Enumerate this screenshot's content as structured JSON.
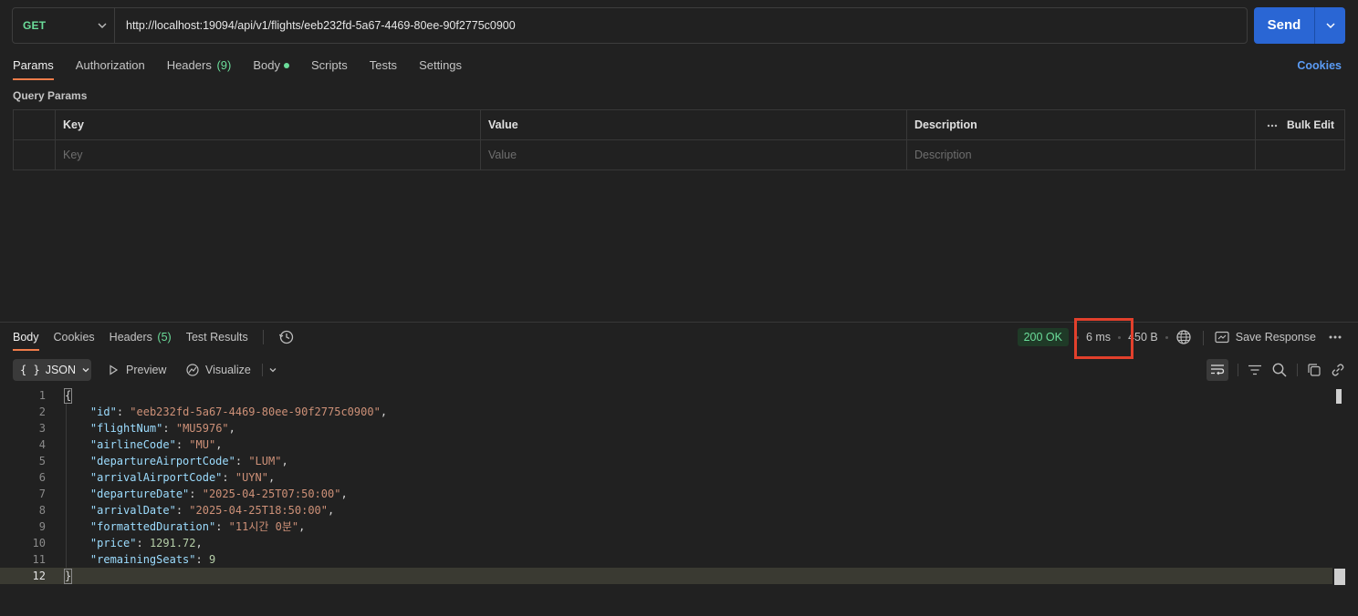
{
  "request": {
    "method": "GET",
    "url": "http://localhost:19094/api/v1/flights/eeb232fd-5a67-4469-80ee-90f2775c0900",
    "send_label": "Send"
  },
  "req_tabs": {
    "params": "Params",
    "authorization": "Authorization",
    "headers": "Headers",
    "headers_count": "(9)",
    "body": "Body",
    "scripts": "Scripts",
    "tests": "Tests",
    "settings": "Settings",
    "cookies": "Cookies"
  },
  "query_params": {
    "title": "Query Params",
    "columns": {
      "key": "Key",
      "value": "Value",
      "description": "Description"
    },
    "bulk_edit": "Bulk Edit",
    "placeholders": {
      "key": "Key",
      "value": "Value",
      "description": "Description"
    }
  },
  "response": {
    "tabs": {
      "body": "Body",
      "cookies": "Cookies",
      "headers": "Headers",
      "headers_count": "(5)",
      "test_results": "Test Results"
    },
    "status": "200 OK",
    "time": "6 ms",
    "size": "450 B",
    "save_response": "Save Response",
    "format": "JSON",
    "format_icon": "{ }",
    "preview": "Preview",
    "visualize": "Visualize",
    "lines": [
      {
        "n": "1",
        "tokens": [
          {
            "t": "p",
            "v": "{"
          }
        ]
      },
      {
        "n": "2",
        "tokens": [
          {
            "t": "p",
            "v": "    "
          },
          {
            "t": "k",
            "v": "\"id\""
          },
          {
            "t": "p",
            "v": ": "
          },
          {
            "t": "s",
            "v": "\"eeb232fd-5a67-4469-80ee-90f2775c0900\""
          },
          {
            "t": "p",
            "v": ","
          }
        ]
      },
      {
        "n": "3",
        "tokens": [
          {
            "t": "p",
            "v": "    "
          },
          {
            "t": "k",
            "v": "\"flightNum\""
          },
          {
            "t": "p",
            "v": ": "
          },
          {
            "t": "s",
            "v": "\"MU5976\""
          },
          {
            "t": "p",
            "v": ","
          }
        ]
      },
      {
        "n": "4",
        "tokens": [
          {
            "t": "p",
            "v": "    "
          },
          {
            "t": "k",
            "v": "\"airlineCode\""
          },
          {
            "t": "p",
            "v": ": "
          },
          {
            "t": "s",
            "v": "\"MU\""
          },
          {
            "t": "p",
            "v": ","
          }
        ]
      },
      {
        "n": "5",
        "tokens": [
          {
            "t": "p",
            "v": "    "
          },
          {
            "t": "k",
            "v": "\"departureAirportCode\""
          },
          {
            "t": "p",
            "v": ": "
          },
          {
            "t": "s",
            "v": "\"LUM\""
          },
          {
            "t": "p",
            "v": ","
          }
        ]
      },
      {
        "n": "6",
        "tokens": [
          {
            "t": "p",
            "v": "    "
          },
          {
            "t": "k",
            "v": "\"arrivalAirportCode\""
          },
          {
            "t": "p",
            "v": ": "
          },
          {
            "t": "s",
            "v": "\"UYN\""
          },
          {
            "t": "p",
            "v": ","
          }
        ]
      },
      {
        "n": "7",
        "tokens": [
          {
            "t": "p",
            "v": "    "
          },
          {
            "t": "k",
            "v": "\"departureDate\""
          },
          {
            "t": "p",
            "v": ": "
          },
          {
            "t": "s",
            "v": "\"2025-04-25T07:50:00\""
          },
          {
            "t": "p",
            "v": ","
          }
        ]
      },
      {
        "n": "8",
        "tokens": [
          {
            "t": "p",
            "v": "    "
          },
          {
            "t": "k",
            "v": "\"arrivalDate\""
          },
          {
            "t": "p",
            "v": ": "
          },
          {
            "t": "s",
            "v": "\"2025-04-25T18:50:00\""
          },
          {
            "t": "p",
            "v": ","
          }
        ]
      },
      {
        "n": "9",
        "tokens": [
          {
            "t": "p",
            "v": "    "
          },
          {
            "t": "k",
            "v": "\"formattedDuration\""
          },
          {
            "t": "p",
            "v": ": "
          },
          {
            "t": "s",
            "v": "\"11시간 0분\""
          },
          {
            "t": "p",
            "v": ","
          }
        ]
      },
      {
        "n": "10",
        "tokens": [
          {
            "t": "p",
            "v": "    "
          },
          {
            "t": "k",
            "v": "\"price\""
          },
          {
            "t": "p",
            "v": ": "
          },
          {
            "t": "n",
            "v": "1291.72"
          },
          {
            "t": "p",
            "v": ","
          }
        ]
      },
      {
        "n": "11",
        "tokens": [
          {
            "t": "p",
            "v": "    "
          },
          {
            "t": "k",
            "v": "\"remainingSeats\""
          },
          {
            "t": "p",
            "v": ": "
          },
          {
            "t": "n",
            "v": "9"
          }
        ]
      },
      {
        "n": "12",
        "tokens": [
          {
            "t": "p",
            "v": "}"
          }
        ]
      }
    ]
  },
  "colors": {
    "accent": "#f07c4a",
    "send": "#2a66d4",
    "method_get": "#6bdd9a",
    "status_ok": "#6bdd9a",
    "highlight": "#e2402c",
    "json_key": "#9cdcfe",
    "json_string": "#ce9178",
    "json_number": "#b5cea8"
  },
  "icons": {
    "method_dropdown": "chevron-down-icon",
    "send_dropdown": "chevron-down-icon",
    "bulk_edit": "more-horizontal-icon",
    "history": "history-icon",
    "network": "globe-icon",
    "save_response": "save-icon",
    "more": "more-horizontal-icon",
    "preview": "play-icon",
    "visualize": "visualize-icon",
    "wrap": "word-wrap-icon",
    "filter": "filter-icon",
    "search": "search-icon",
    "copy": "copy-icon",
    "link": "link-icon"
  }
}
